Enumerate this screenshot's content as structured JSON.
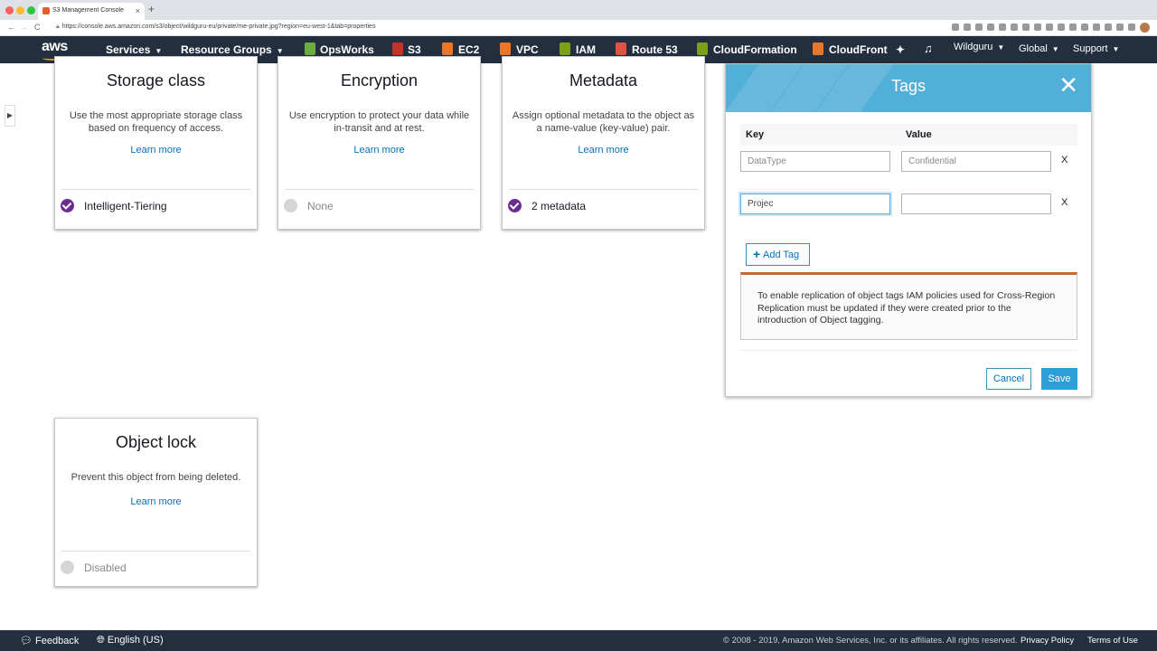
{
  "browser": {
    "tab_title": "S3 Management Console",
    "tab_close": "×",
    "new_tab": "+",
    "back": "←",
    "forward": "→",
    "reload": "C",
    "url": "https://console.aws.amazon.com/s3/object/wildguru-eu/private/me-private.jpg?region=eu-west-1&tab=properties"
  },
  "nav": {
    "logo": "aws",
    "services": "Services",
    "resource_groups": "Resource Groups",
    "shortcuts": [
      {
        "label": "OpsWorks",
        "color": "#6cae3e"
      },
      {
        "label": "S3",
        "color": "#c7312a"
      },
      {
        "label": "EC2",
        "color": "#e8762b"
      },
      {
        "label": "VPC",
        "color": "#e8762b"
      },
      {
        "label": "IAM",
        "color": "#7aa116"
      },
      {
        "label": "Route 53",
        "color": "#e05243"
      },
      {
        "label": "CloudFormation",
        "color": "#7aa116"
      },
      {
        "label": "CloudFront",
        "color": "#e8762b"
      }
    ],
    "account": "Wildguru",
    "region": "Global",
    "support": "Support"
  },
  "sidebar_toggle": "▶",
  "cards": {
    "storage": {
      "title": "Storage class",
      "desc": "Use the most appropriate storage class based on frequency of access.",
      "link": "Learn more",
      "status": "Intelligent-Tiering"
    },
    "encryption": {
      "title": "Encryption",
      "desc": "Use encryption to protect your data while in-transit and at rest.",
      "link": "Learn more",
      "status": "None"
    },
    "metadata": {
      "title": "Metadata",
      "desc": "Assign optional metadata to the object as a name-value (key-value) pair.",
      "link": "Learn more",
      "status": "2 metadata"
    },
    "objectlock": {
      "title": "Object lock",
      "desc": "Prevent this object from being deleted.",
      "link": "Learn more",
      "status": "Disabled"
    }
  },
  "tags_panel": {
    "title": "Tags",
    "close": "✕",
    "col_key": "Key",
    "col_value": "Value",
    "rows": [
      {
        "key_placeholder": "DataType",
        "value_placeholder": "Confidential",
        "key": "",
        "value": ""
      },
      {
        "key_placeholder": "",
        "value_placeholder": "",
        "key": "Projec",
        "value": ""
      }
    ],
    "remove": "X",
    "add_plus": "+",
    "add_tag": "Add Tag",
    "warning": "To enable replication of object tags IAM policies used for Cross-Region Replication must be updated if they were created prior to the introduction of Object tagging.",
    "cancel": "Cancel",
    "save": "Save"
  },
  "footer": {
    "feedback": "Feedback",
    "language": "English (US)",
    "copyright": "© 2008 - 2019, Amazon Web Services, Inc. or its affiliates. All rights reserved.",
    "privacy": "Privacy Policy",
    "terms": "Terms of Use"
  }
}
